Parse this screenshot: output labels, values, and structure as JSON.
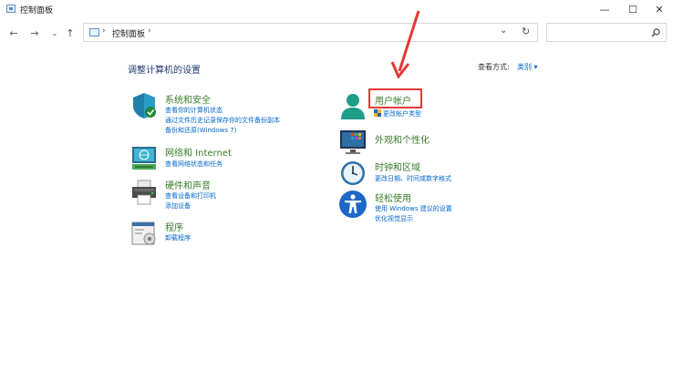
{
  "window": {
    "title": "控制面板"
  },
  "address": {
    "path": "控制面板",
    "separator": "›"
  },
  "search": {
    "placeholder": ""
  },
  "heading": {
    "title": "调整计算机的设置",
    "view_by_label": "查看方式:",
    "view_by_value": "类别 ▾"
  },
  "categories_left": [
    {
      "title": "系统和安全",
      "links": [
        "查看你的计算机状态",
        "通过文件历史记录保存你的文件备份副本",
        "备份和还原(Windows 7)"
      ]
    },
    {
      "title": "网络和 Internet",
      "links": [
        "查看网络状态和任务"
      ]
    },
    {
      "title": "硬件和声音",
      "links": [
        "查看设备和打印机",
        "添加设备"
      ]
    },
    {
      "title": "程序",
      "links": [
        "卸载程序"
      ]
    }
  ],
  "categories_right": [
    {
      "title": "用户帐户",
      "links": [
        "更改帐户类型"
      ]
    },
    {
      "title": "外观和个性化",
      "links": []
    },
    {
      "title": "时钟和区域",
      "links": [
        "更改日期、时间或数字格式"
      ]
    },
    {
      "title": "轻松使用",
      "links": [
        "使用 Windows 建议的设置",
        "优化视觉显示"
      ]
    }
  ],
  "colors": {
    "link": "#0066cc",
    "category_title": "#3a7d2a",
    "highlight": "#e53935",
    "arrow": "#e53935"
  },
  "icons": [
    "shield-icon",
    "network-icon",
    "printer-icon",
    "program-icon",
    "user-icon",
    "monitor-icon",
    "clock-icon",
    "accessibility-icon",
    "search-icon",
    "refresh-icon"
  ]
}
